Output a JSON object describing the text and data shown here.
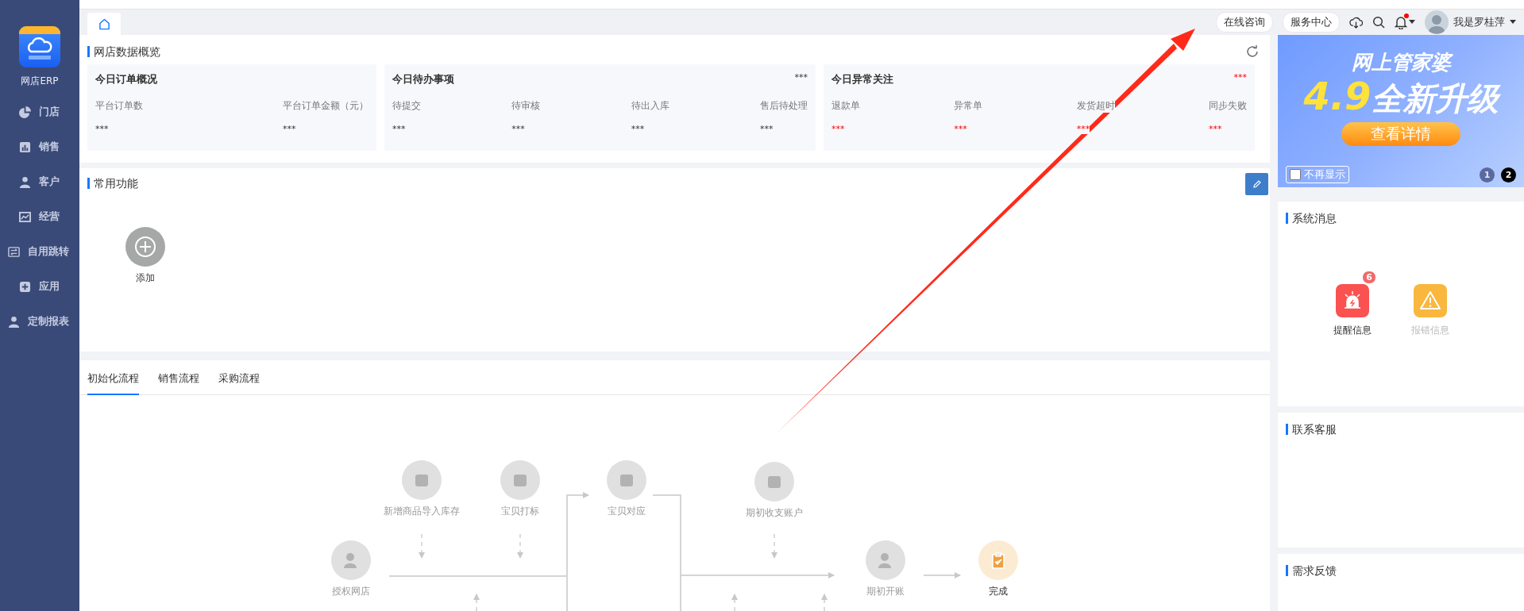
{
  "sidebar": {
    "app_name": "网店ERP",
    "items": [
      {
        "label": "门店"
      },
      {
        "label": "销售"
      },
      {
        "label": "客户"
      },
      {
        "label": "经营"
      },
      {
        "label": "自用跳转"
      },
      {
        "label": "应用"
      },
      {
        "label": "定制报表"
      }
    ]
  },
  "header": {
    "links": [
      "在线咨询",
      "服务中心"
    ],
    "notification_unread": true,
    "user_name": "我是罗桂萍"
  },
  "overview": {
    "title": "网店数据概览",
    "cards": [
      {
        "title": "今日订单概况",
        "alert": false,
        "metrics": [
          {
            "label": "平台订单数",
            "value": "***"
          },
          {
            "label": "平台订单金额（元）",
            "value": "***"
          }
        ]
      },
      {
        "title": "今日待办事项",
        "corner": "***",
        "alert": false,
        "metrics": [
          {
            "label": "待提交",
            "value": "***"
          },
          {
            "label": "待审核",
            "value": "***"
          },
          {
            "label": "待出入库",
            "value": "***"
          },
          {
            "label": "售后待处理",
            "value": "***"
          }
        ]
      },
      {
        "title": "今日异常关注",
        "corner": "***",
        "alert": true,
        "metrics": [
          {
            "label": "退款单",
            "value": "***"
          },
          {
            "label": "异常单",
            "value": "***"
          },
          {
            "label": "发货超时",
            "value": "***"
          },
          {
            "label": "同步失败",
            "value": "***"
          }
        ]
      }
    ]
  },
  "functions": {
    "title": "常用功能",
    "add_label": "添加"
  },
  "flows": {
    "tabs": [
      {
        "label": "初始化流程",
        "selected": true
      },
      {
        "label": "销售流程",
        "selected": false
      },
      {
        "label": "采购流程",
        "selected": false
      }
    ],
    "steps": [
      {
        "label": "新增商品导入库存",
        "kind": "step"
      },
      {
        "label": "宝贝打标",
        "kind": "step"
      },
      {
        "label": "宝贝对应",
        "kind": "step"
      },
      {
        "label": "期初收支账户",
        "kind": "step"
      },
      {
        "label": "授权网店",
        "kind": "step"
      },
      {
        "label": "期初开账",
        "kind": "step"
      },
      {
        "label": "完成",
        "kind": "finish"
      }
    ]
  },
  "banner": {
    "brand": "网上管家婆",
    "version": "4.9",
    "headline": "全新升级",
    "button": "查看详情",
    "dismiss": {
      "label": "不再显示",
      "checked": false
    },
    "pages": [
      {
        "label": "1",
        "selected": false
      },
      {
        "label": "2",
        "selected": true
      }
    ]
  },
  "messages": {
    "title": "系统消息",
    "items": [
      {
        "label": "提醒信息",
        "badge": "6",
        "disabled": false,
        "kind": "reminder"
      },
      {
        "label": "报错信息",
        "disabled": true,
        "kind": "error"
      }
    ]
  },
  "contact": {
    "title": "联系客服"
  },
  "feedback": {
    "title": "需求反馈"
  }
}
